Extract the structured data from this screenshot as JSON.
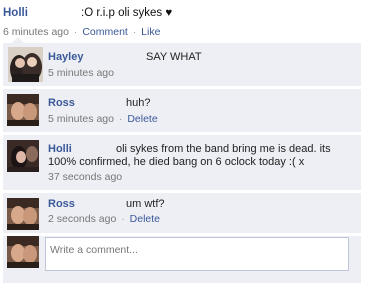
{
  "post": {
    "author": "Holli",
    "text": ":O r.i.p oli sykes ♥",
    "time": "6 minutes ago",
    "separator": "·",
    "comment_link": "Comment",
    "like_link": "Like"
  },
  "comments": [
    {
      "author": "Hayley",
      "text": "SAY WHAT",
      "time": "5 minutes ago"
    },
    {
      "author": "Ross",
      "text": "huh?",
      "time": "5 minutes ago",
      "action": "Delete"
    },
    {
      "author": "Holli",
      "text": "oli sykes from the band bring me is dead. its 100% confirmed, he died bang on 6 oclock today :( x",
      "time": "37 seconds ago"
    },
    {
      "author": "Ross",
      "text": "um wtf?",
      "time": "2 seconds ago",
      "action": "Delete"
    }
  ],
  "write_comment": {
    "placeholder": "Write a comment..."
  },
  "colors": {
    "link": "#3b5998",
    "comment_bg": "#edeff4",
    "meta": "#777777"
  }
}
